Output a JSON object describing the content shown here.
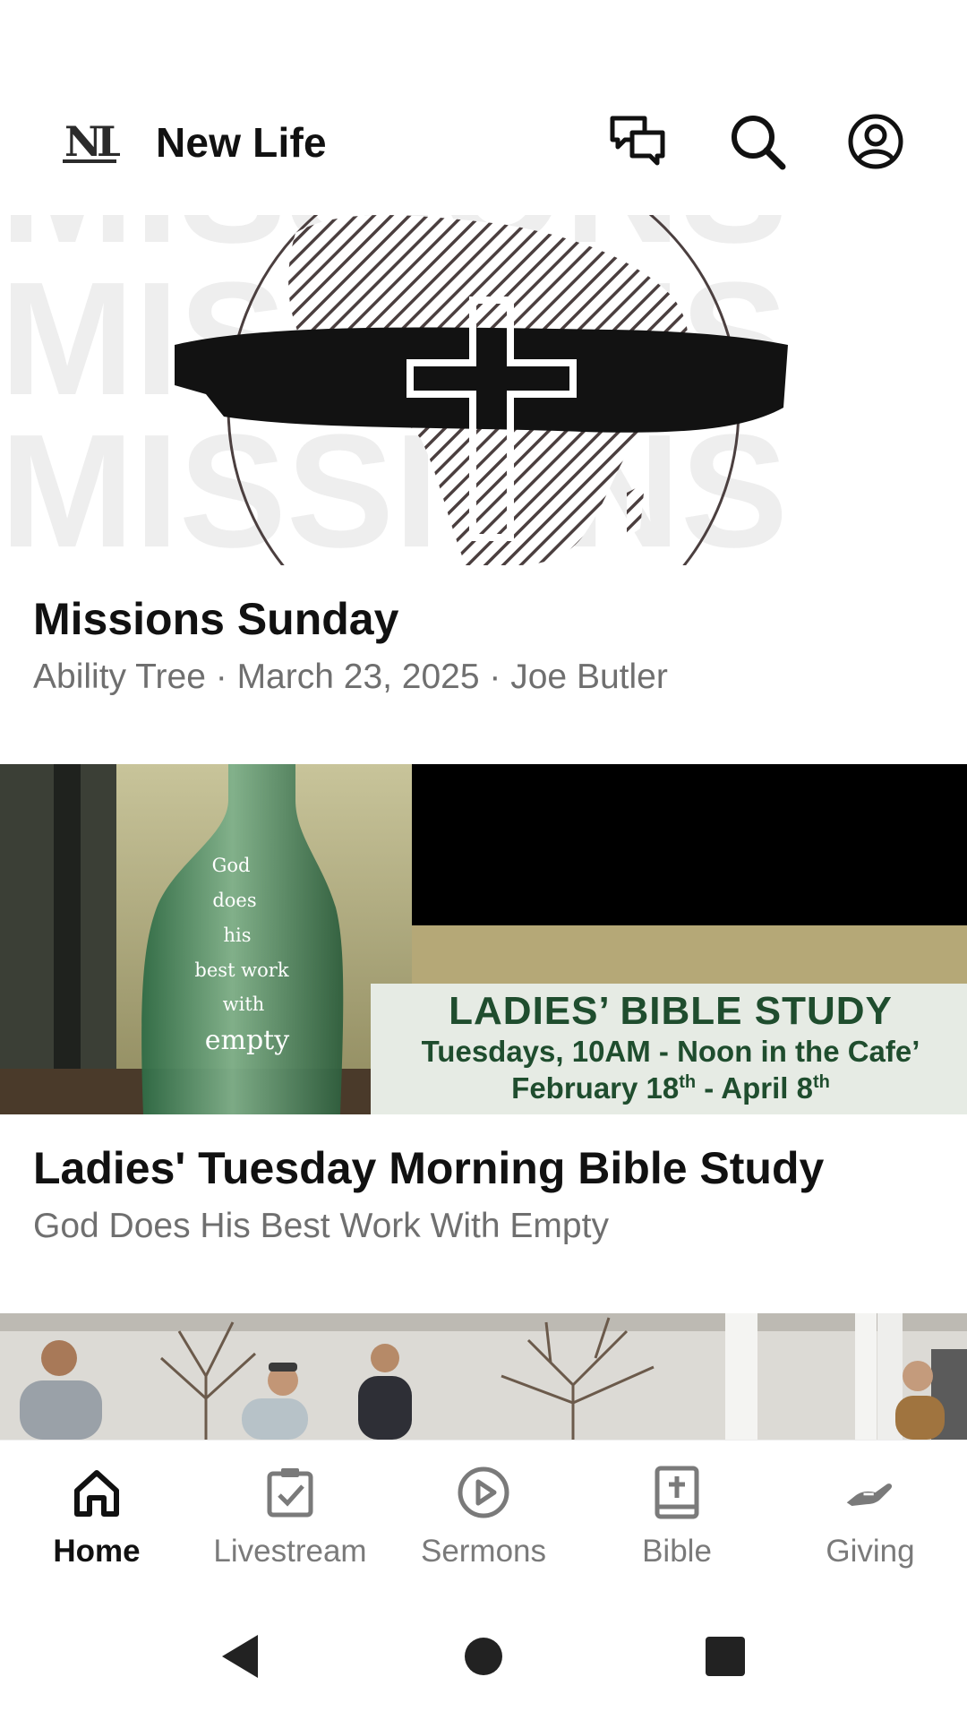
{
  "app": {
    "title": "New Life",
    "logo_text": "NL"
  },
  "header": {
    "icons": [
      "chat-icon",
      "search-icon",
      "account-icon"
    ]
  },
  "feed": [
    {
      "title": "Missions Sunday",
      "subtitle": "Ability Tree · March 23, 2025 · Joe Butler",
      "image": {
        "background_words": [
          "MISSIONS",
          "MISSIONS",
          "MISSIONS",
          "MISSIONS"
        ]
      }
    },
    {
      "title": "Ladies' Tuesday Morning Bible Study",
      "subtitle": "God Does His Best Work With Empty",
      "image": {
        "bottle_lines": [
          "God",
          "does",
          "his",
          "best work",
          "with",
          "empty"
        ],
        "banner_title": "LADIES’ BIBLE STUDY",
        "banner_line1": "Tuesdays, 10AM - Noon in the Cafe’",
        "banner_line2_a": "February 18",
        "banner_line2_sup1": "th",
        "banner_line2_b": " - April 8",
        "banner_line2_sup2": "th"
      }
    },
    {
      "title": "",
      "subtitle": "",
      "image": {}
    }
  ],
  "tabs": [
    {
      "label": "Home",
      "icon": "home-icon",
      "active": true
    },
    {
      "label": "Livestream",
      "icon": "clipboard-check-icon",
      "active": false
    },
    {
      "label": "Sermons",
      "icon": "play-circle-icon",
      "active": false
    },
    {
      "label": "Bible",
      "icon": "bible-icon",
      "active": false
    },
    {
      "label": "Giving",
      "icon": "giving-hand-icon",
      "active": false
    }
  ],
  "colors": {
    "active_tab": "#111111",
    "inactive_tab": "#7a7a7a",
    "subtitle": "#6f6f6f",
    "banner_green": "#1f4d2e",
    "banner_bg": "#e6ebe4",
    "banner_tan": "#b5a877"
  }
}
